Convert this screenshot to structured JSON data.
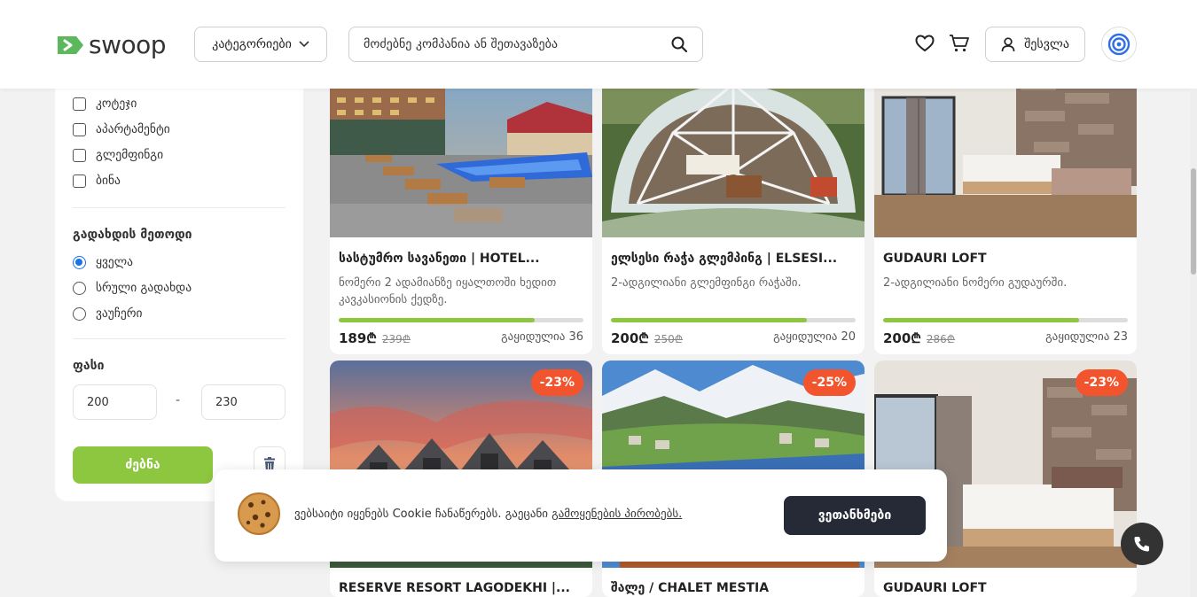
{
  "brand": {
    "name": "swoop",
    "accent": "#8dc63f"
  },
  "header": {
    "categories_label": "კატეგორიები",
    "search_placeholder": "მოძებნე კომპანია ან შეთავაზება",
    "login_label": "შესვლა",
    "icons": [
      "heart-icon",
      "cart-icon",
      "user-icon",
      "brand-circle-icon",
      "search-icon",
      "chevron-down-icon"
    ]
  },
  "filters": {
    "property_types": [
      {
        "label": "კოტეჯი",
        "checked": false
      },
      {
        "label": "აპარტამენტი",
        "checked": false
      },
      {
        "label": "გლემფინგი",
        "checked": false
      },
      {
        "label": "ბინა",
        "checked": false
      }
    ],
    "payment_title": "გადახდის მეთოდი",
    "payment_options": [
      {
        "label": "ყველა",
        "selected": true
      },
      {
        "label": "სრული გადახდა",
        "selected": false
      },
      {
        "label": "ვაუჩერი",
        "selected": false
      }
    ],
    "price_title": "ფასი",
    "price_min": "200",
    "price_max": "230",
    "price_separator": "-",
    "search_button": "ძებნა"
  },
  "cards": [
    {
      "title": "სასტუმრო სავანეთი | HOTEL...",
      "desc": "ნომერი 2 ადამიანზე იყალთოში ხედით კავკასიონის ქედზე.",
      "price": "189₾",
      "old_price": "239₾",
      "sold": "გაყიდულია 36",
      "progress": 0.8,
      "badge": ""
    },
    {
      "title": "ელსესი რაჭა გლემპინგ | ELSESI...",
      "desc": "2-ადგილიანი გლემფინგი რაჭაში.",
      "price": "200₾",
      "old_price": "250₾",
      "sold": "გაყიდულია 20",
      "progress": 0.8,
      "badge": ""
    },
    {
      "title": "GUDAURI LOFT",
      "desc": "2-ადგილიანი ნომერი გუდაურში.",
      "price": "200₾",
      "old_price": "286₾",
      "sold": "გაყიდულია 23",
      "progress": 0.8,
      "badge": ""
    },
    {
      "title": "RESERVE RESORT LAGODEKHI |...",
      "desc": "",
      "price": "",
      "old_price": "",
      "sold": "",
      "progress": 0,
      "badge": "-23%"
    },
    {
      "title": "შალე / CHALET MESTIA",
      "desc": "",
      "price": "",
      "old_price": "",
      "sold": "",
      "progress": 0,
      "badge": "-25%"
    },
    {
      "title": "GUDAURI LOFT",
      "desc": "",
      "price": "",
      "old_price": "",
      "sold": "",
      "progress": 0,
      "badge": "-23%"
    }
  ],
  "cookie": {
    "text": "ვებსაიტი იყენებს Cookie ჩანაწერებს. გაეცანი ",
    "link": "გამოყენების პირობებს.",
    "button": "ვეთანხმები"
  }
}
